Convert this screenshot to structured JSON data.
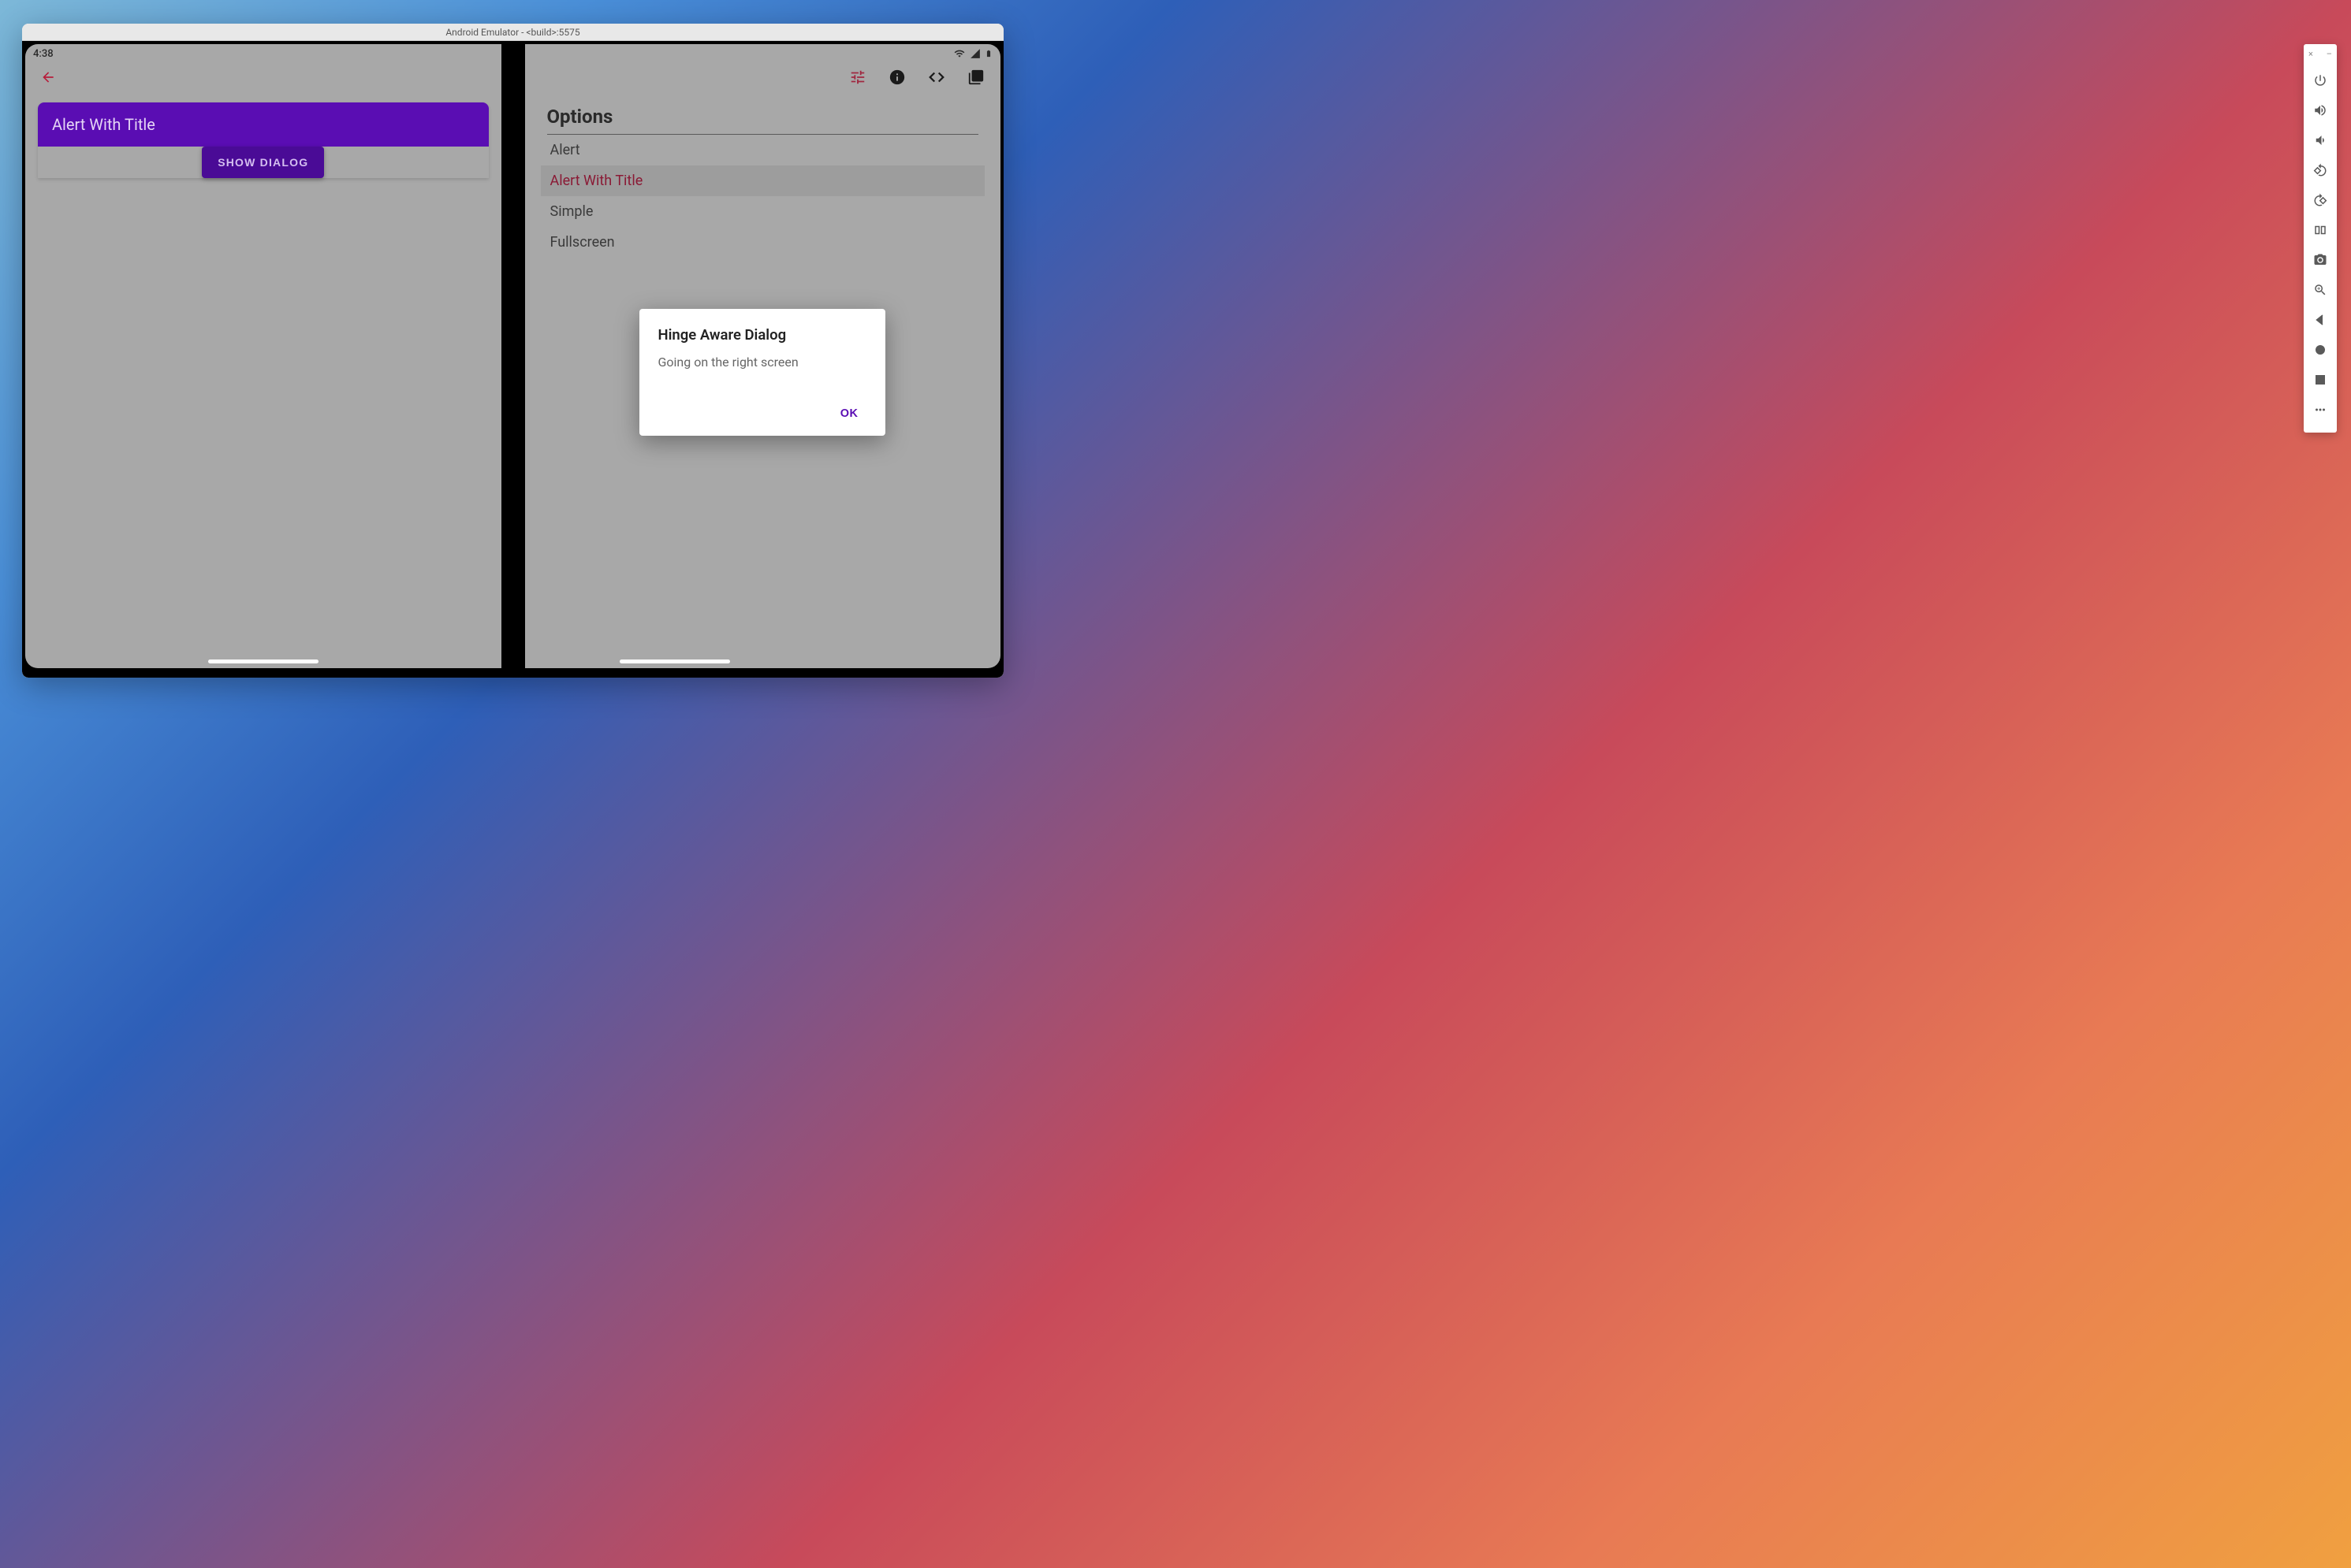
{
  "emulator": {
    "title": "Android Emulator - <build>:5575"
  },
  "statusBar": {
    "time": "4:38"
  },
  "leftPane": {
    "headerTitle": "Alert With Title",
    "showButtonLabel": "SHOW DIALOG"
  },
  "rightPane": {
    "optionsTitle": "Options",
    "options": [
      {
        "label": "Alert",
        "selected": false
      },
      {
        "label": "Alert With Title",
        "selected": true
      },
      {
        "label": "Simple",
        "selected": false
      },
      {
        "label": "Fullscreen",
        "selected": false
      }
    ]
  },
  "dialog": {
    "title": "Hinge Aware Dialog",
    "body": "Going on the right screen",
    "ok": "OK"
  },
  "sideToolbar": {
    "closeGlyph": "×",
    "minGlyph": "–"
  },
  "icons": {
    "back": "back-icon",
    "tune": "tune-icon",
    "info": "info-icon",
    "code": "code-icon",
    "library": "library-icon",
    "wifi": "wifi-icon",
    "signal": "signal-icon",
    "battery": "battery-icon"
  }
}
